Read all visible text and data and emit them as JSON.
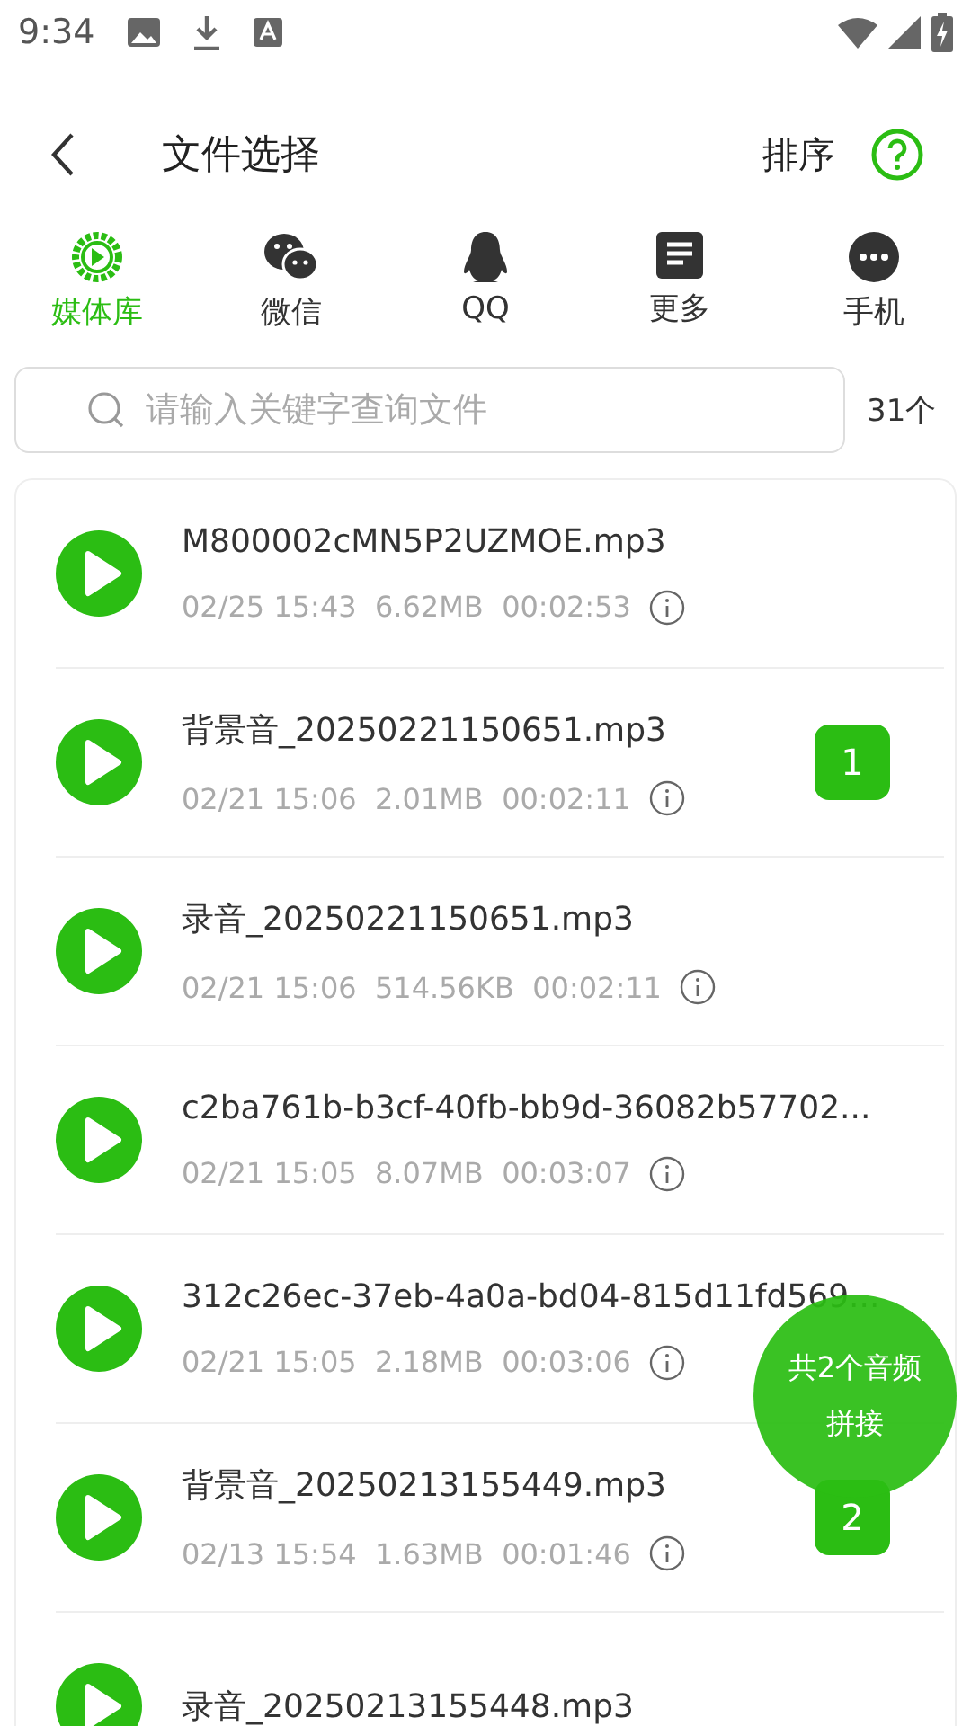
{
  "status_bar": {
    "time": "9:34"
  },
  "header": {
    "title": "文件选择",
    "sort": "排序"
  },
  "tabs": [
    {
      "label": "媒体库",
      "selected": true
    },
    {
      "label": "微信",
      "selected": false
    },
    {
      "label": "QQ",
      "selected": false
    },
    {
      "label": "更多",
      "selected": false
    },
    {
      "label": "手机",
      "selected": false
    }
  ],
  "search": {
    "placeholder": "请输入关键字查询文件",
    "count": "31个"
  },
  "files": [
    {
      "name": "M800002cMN5P2UZMOE.mp3",
      "date": "02/25 15:43",
      "size": "6.62MB",
      "duration": "00:02:53",
      "selected": false
    },
    {
      "name": "背景音_20250221150651.mp3",
      "date": "02/21 15:06",
      "size": "2.01MB",
      "duration": "00:02:11",
      "selected": true,
      "order": "1"
    },
    {
      "name": "录音_20250221150651.mp3",
      "date": "02/21 15:06",
      "size": "514.56KB",
      "duration": "00:02:11",
      "selected": false
    },
    {
      "name": "c2ba761b-b3cf-40fb-bb9d-36082b57702...",
      "date": "02/21 15:05",
      "size": "8.07MB",
      "duration": "00:03:07",
      "selected": false
    },
    {
      "name": "312c26ec-37eb-4a0a-bd04-815d11fd569...",
      "date": "02/21 15:05",
      "size": "2.18MB",
      "duration": "00:03:06",
      "selected": false
    },
    {
      "name": "背景音_20250213155449.mp3",
      "date": "02/13 15:54",
      "size": "1.63MB",
      "duration": "00:01:46",
      "selected": true,
      "order": "2"
    },
    {
      "name": "录音_20250213155448.mp3",
      "selected": false
    }
  ],
  "merge_button": {
    "line1": "共2个音频",
    "line2": "拼接"
  }
}
